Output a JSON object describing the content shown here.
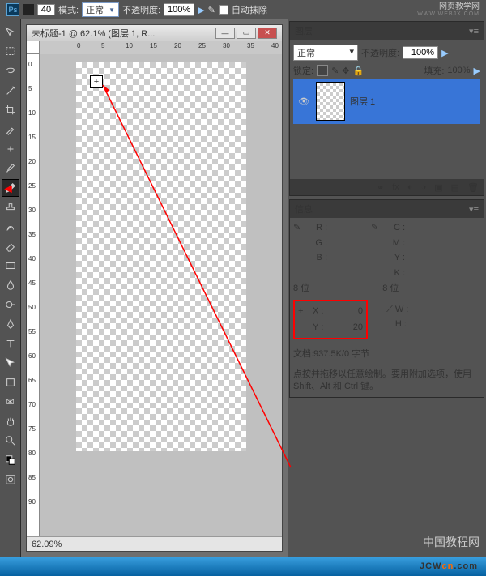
{
  "topbar": {
    "brush_size": "40",
    "mode_label": "模式:",
    "mode_value": "正常",
    "opacity_label": "不透明度:",
    "opacity_value": "100%",
    "auto_erase_label": "自动抹除",
    "site_cn": "网页教学网",
    "site_en": "WWW.WEBJX.COM"
  },
  "document": {
    "title": "未标题-1 @ 62.1% (图层 1, R...",
    "zoom": "62.09%",
    "ruler_h": [
      "0",
      "5",
      "10",
      "15",
      "20",
      "25",
      "30",
      "35",
      "40"
    ],
    "ruler_v": [
      "0",
      "5",
      "10",
      "15",
      "20",
      "25",
      "30",
      "35",
      "40",
      "45",
      "50",
      "55",
      "60",
      "65",
      "70",
      "75",
      "80",
      "85",
      "90"
    ]
  },
  "layers_panel": {
    "title": "图层",
    "blend_mode": "正常",
    "opacity_label": "不透明度:",
    "opacity_value": "100%",
    "lock_label": "锁定:",
    "fill_label": "填充:",
    "fill_value": "100%",
    "layer_name": "图层 1",
    "footer_icons": [
      "fx",
      "◐",
      "▣",
      "◑",
      "▤",
      "✎"
    ]
  },
  "info_panel": {
    "title": "信息",
    "R": "R :",
    "G": "G :",
    "B": "B :",
    "C": "C :",
    "M": "M :",
    "Y": "Y :",
    "K": "K :",
    "bits_left": "8 位",
    "bits_right": "8 位",
    "X_label": "X :",
    "X_value": "0",
    "Y_label": "Y :",
    "Y_value": "20",
    "W_label": "W :",
    "H_label": "H :",
    "doc": "文档:937.5K/0 字节",
    "hint": "点按并拖移以任意绘制。要用附加选项，使用 Shift、Alt 和 Ctrl 键。"
  },
  "watermark": "中国教程网",
  "footer_brand": {
    "a": "JCW",
    "b": "cn",
    "c": ".com"
  }
}
